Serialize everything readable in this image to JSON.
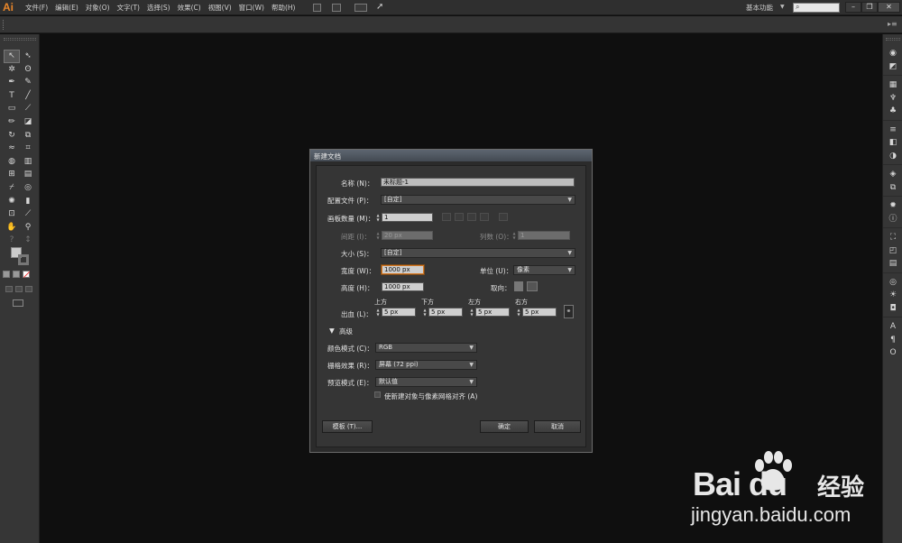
{
  "app": {
    "logo": "Ai"
  },
  "menu": {
    "items": [
      "文件(F)",
      "编辑(E)",
      "对象(O)",
      "文字(T)",
      "选择(S)",
      "效果(C)",
      "视图(V)",
      "窗口(W)",
      "帮助(H)"
    ]
  },
  "workspace": {
    "label": "基本功能"
  },
  "colors": {
    "accent": "#d77a25",
    "app_bg": "#0f0f0f",
    "panel": "#363636"
  },
  "tools": [
    "selection-tool",
    "direct-selection-tool",
    "magic-wand-tool",
    "lasso-tool",
    "pen-tool",
    "curvature-tool",
    "type-tool",
    "line-tool",
    "rectangle-tool",
    "paintbrush-tool",
    "pencil-tool",
    "eraser-tool",
    "rotate-tool",
    "scale-tool",
    "width-tool",
    "free-transform-tool",
    "shape-builder-tool",
    "perspective-tool",
    "mesh-tool",
    "gradient-tool",
    "eyedropper-tool",
    "blend-tool",
    "symbol-sprayer-tool",
    "column-graph-tool",
    "artboard-tool",
    "slice-tool",
    "hand-tool",
    "zoom-tool"
  ],
  "dialog": {
    "title": "新建文档",
    "name_label": "名称 (N)：",
    "name_value": "未标题-1",
    "profile_label": "配置文件 (P)：",
    "profile_value": "[自定]",
    "artboards_label": "画板数量 (M)：",
    "artboards_value": "1",
    "spacing_label": "间距 (I)：",
    "spacing_value": "20 px",
    "columns_label": "列数 (O)：",
    "columns_value": "1",
    "size_label": "大小 (S)：",
    "size_value": "[自定]",
    "width_label": "宽度 (W)：",
    "width_value": "1000 px",
    "units_label": "单位 (U)：",
    "units_value": "像素",
    "height_label": "高度 (H)：",
    "height_value": "1000 px",
    "orientation_label": "取向：",
    "bleed_label": "出血 (L)：",
    "bleed_top_label": "上方",
    "bleed_bottom_label": "下方",
    "bleed_left_label": "左方",
    "bleed_right_label": "右方",
    "bleed_top": "5 px",
    "bleed_bottom": "5 px",
    "bleed_left": "5 px",
    "bleed_right": "5 px",
    "advanced_label": "高级",
    "colormode_label": "颜色模式 (C)：",
    "colormode_value": "RGB",
    "raster_label": "栅格效果 (R)：",
    "raster_value": "屏幕 (72 ppi)",
    "preview_label": "预览模式 (E)：",
    "preview_value": "默认值",
    "align_label": "使新建对象与像素网格对齐 (A)",
    "templates_button": "模板 (T)...",
    "ok_button": "确定",
    "cancel_button": "取消"
  },
  "watermark": {
    "brand": "Bai du",
    "cn": "经验",
    "url": "jingyan.baidu.com"
  }
}
